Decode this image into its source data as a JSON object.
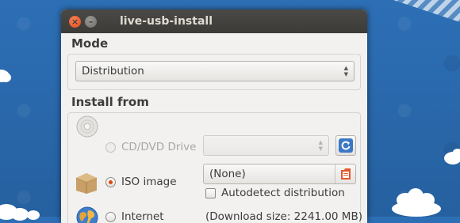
{
  "window": {
    "title": "live-usb-install",
    "close_glyph": "×",
    "minimize_glyph": "–"
  },
  "mode": {
    "label": "Mode",
    "selected": "Distribution"
  },
  "install_from": {
    "label": "Install from",
    "cd_option": "CD/DVD Drive",
    "cd_selected_value": "",
    "iso_option": "ISO image",
    "iso_file_value": "(None)",
    "autodetect_label": "Autodetect distribution",
    "autodetect_checked": false,
    "internet_option": "Internet",
    "download_size": "(Download size: 2241.00 MB)",
    "selected_option": "ISO image"
  },
  "icons": {
    "cd": "cd-disc-icon",
    "iso": "package-box-icon",
    "internet": "globe-icon",
    "refresh": "refresh-icon",
    "file_open": "file-open-icon"
  },
  "colors": {
    "accent": "#dd4814",
    "titlebar": "#3c3b37"
  }
}
